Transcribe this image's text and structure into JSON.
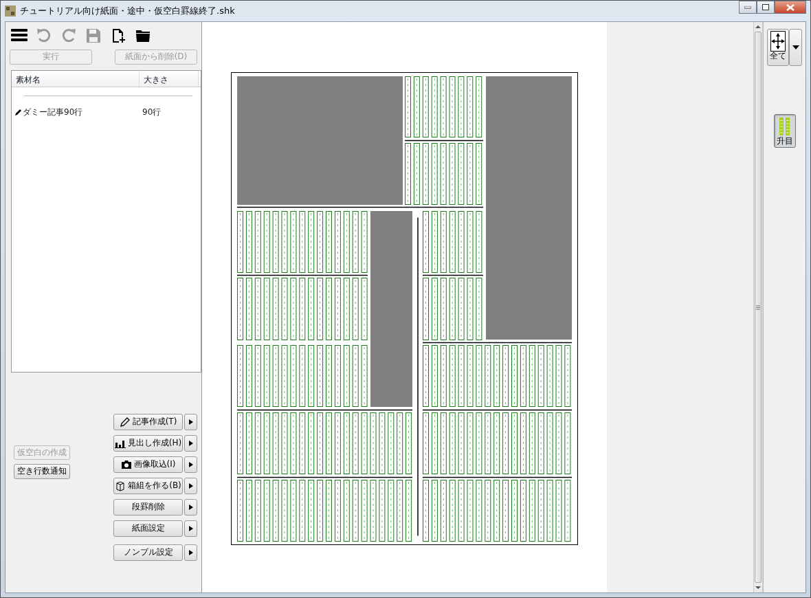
{
  "window": {
    "title": "チュートリアル向け紙面・途中・仮空白罫線終了.shk"
  },
  "toolbar": [
    {
      "kind": "menu",
      "disabled": false
    },
    {
      "kind": "undo",
      "disabled": true
    },
    {
      "kind": "redo",
      "disabled": true
    },
    {
      "kind": "save",
      "disabled": true
    },
    {
      "kind": "new",
      "disabled": false
    },
    {
      "kind": "open",
      "disabled": false
    }
  ],
  "action_buttons": [
    {
      "label": "実行",
      "disabled": true
    },
    {
      "label": "紙面から削除(D)",
      "disabled": true
    }
  ],
  "table": {
    "columns": [
      "素材名",
      "大きさ"
    ],
    "rows": [
      {
        "name": "ダミー記事90行",
        "size": "90行"
      }
    ]
  },
  "side_buttons": [
    {
      "label": "仮空白の作成",
      "disabled": true
    },
    {
      "label": "空き行数通知",
      "disabled": false
    }
  ],
  "create_buttons": [
    {
      "label": "記事作成(T)",
      "kind": "pencil"
    },
    {
      "label": "見出し作成(H)",
      "kind": "bars"
    },
    {
      "label": "画像取込(I)",
      "kind": "camera"
    },
    {
      "label": "箱組を作る(B)",
      "kind": "box"
    },
    {
      "label": "段罫削除",
      "kind": "plain"
    },
    {
      "label": "紙面設定",
      "kind": "plain"
    },
    {
      "label": "ノンブル設定",
      "kind": "plain"
    }
  ],
  "right_tools": [
    {
      "label": "全て",
      "kind": "move",
      "on": false
    },
    {
      "label": "升目",
      "kind": "grid",
      "on": true
    }
  ]
}
